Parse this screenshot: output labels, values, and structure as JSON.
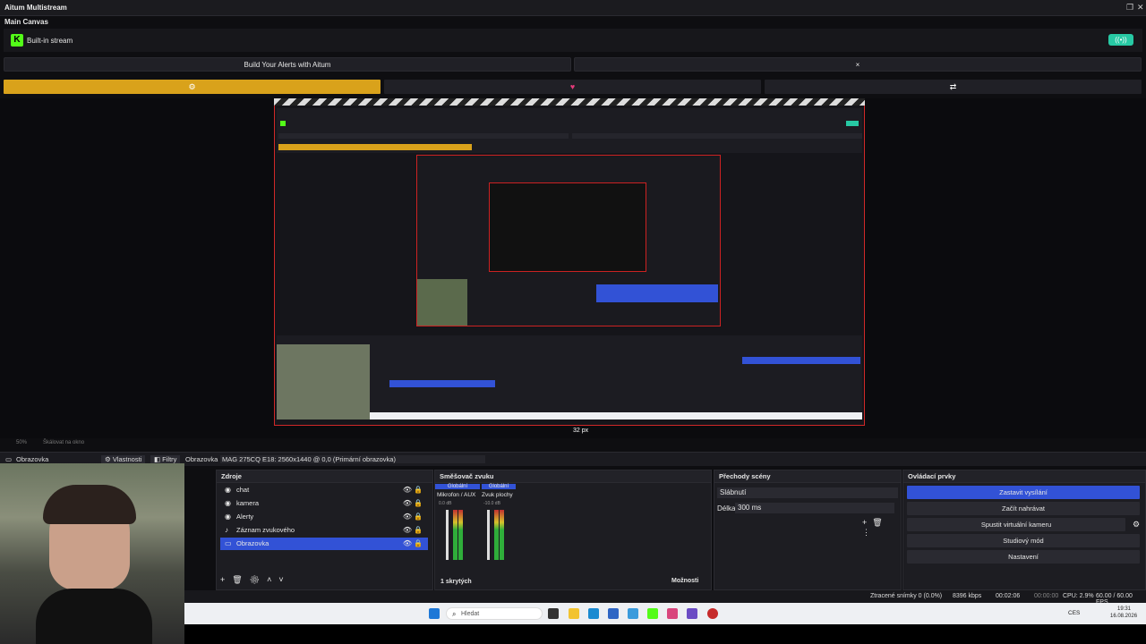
{
  "titlebar": {
    "title": "Aitum Multistream",
    "restore_icon": "restore-icon",
    "close_icon": "close-icon"
  },
  "canvas": {
    "label": "Main Canvas"
  },
  "stream": {
    "name": "Built-in stream",
    "platform_icon": "K",
    "status_icon": "((•))"
  },
  "buttons": {
    "alerts": "Build Your Alerts with Aitum",
    "close": "×"
  },
  "progress": {
    "gear": "⚙",
    "heart": "♥",
    "arrows": "⇄"
  },
  "preview": {
    "resize_label": "32 px"
  },
  "zoom": {
    "percent": "50%",
    "label": "Škálovat na okno"
  },
  "srcbar": {
    "source": "Obrazovka",
    "properties": "Vlastnosti",
    "filters": "Filtry",
    "display_label": "Obrazovka",
    "display_value": "MAG 275CQ E18: 2560x1440 @ 0,0 (Primární obrazovka)"
  },
  "sources": {
    "title": "Zdroje",
    "items": [
      {
        "label": "chat"
      },
      {
        "label": "kamera"
      },
      {
        "label": "Alerty"
      },
      {
        "label": "Záznam zvukového"
      },
      {
        "label": "Obrazovka"
      }
    ]
  },
  "mixer": {
    "title": "Směšovač zvuku",
    "tab1": "Globální",
    "tab2": "Globální",
    "ch1": "Mikrofon / AUX",
    "ch2": "Zvuk plochy",
    "db1": "0.0 dB",
    "db2": "-10.0 dB",
    "hidden": "1 skrytých",
    "options": "Možnosti"
  },
  "transitions": {
    "title": "Přechody scény",
    "type": "Slábnutí",
    "duration_label": "Délka",
    "duration": "300 ms"
  },
  "controls": {
    "title": "Ovládací prvky",
    "stop_stream": "Zastavit vysílání",
    "start_record": "Začít nahrávat",
    "virtual_cam": "Spustit virtuální kameru",
    "studio": "Studiový mód",
    "settings": "Nastavení"
  },
  "status": {
    "dropped": "Ztracené snímky 0 (0.0%)",
    "bitrate": "8396 kbps",
    "stream_time": "00:02:06",
    "rec_time": "00:00:00",
    "cpu": "CPU: 2.9%",
    "fps": "60.00 / 60.00 FPS"
  },
  "taskbar": {
    "search": "Hledat",
    "lang": "CES",
    "time": "19:31",
    "date": "16.08.2026"
  }
}
